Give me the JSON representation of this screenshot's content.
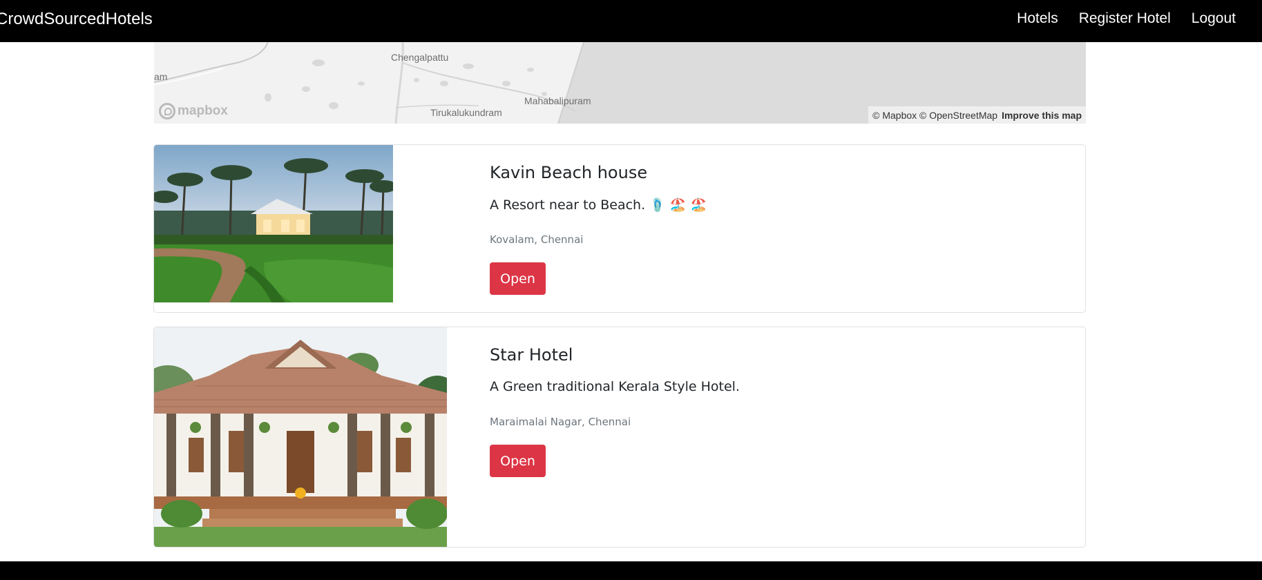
{
  "navbar": {
    "brand": "CrowdSourcedHotels",
    "links": [
      "Hotels",
      "Register Hotel",
      "Logout"
    ]
  },
  "map": {
    "places": [
      "Chengalpattu",
      "Mahabalipuram",
      "Tirukalukundram",
      "am"
    ],
    "logo_text": "mapbox",
    "attribution": "© Mapbox © OpenStreetMap",
    "improve_link": "Improve this map"
  },
  "hotels": [
    {
      "name": "Kavin Beach house",
      "description": "A Resort near to Beach. 🩴 🏖️ 🏖️",
      "location": "Kovalam, Chennai",
      "button": "Open",
      "image_icon": "resort-photo"
    },
    {
      "name": "Star Hotel",
      "description": "A Green traditional Kerala Style Hotel.",
      "location": "Maraimalai Nagar, Chennai",
      "button": "Open",
      "image_icon": "kerala-house-photo"
    }
  ],
  "colors": {
    "navbar_bg": "#000000",
    "open_button": "#dc3545",
    "muted_text": "#6c757d"
  }
}
